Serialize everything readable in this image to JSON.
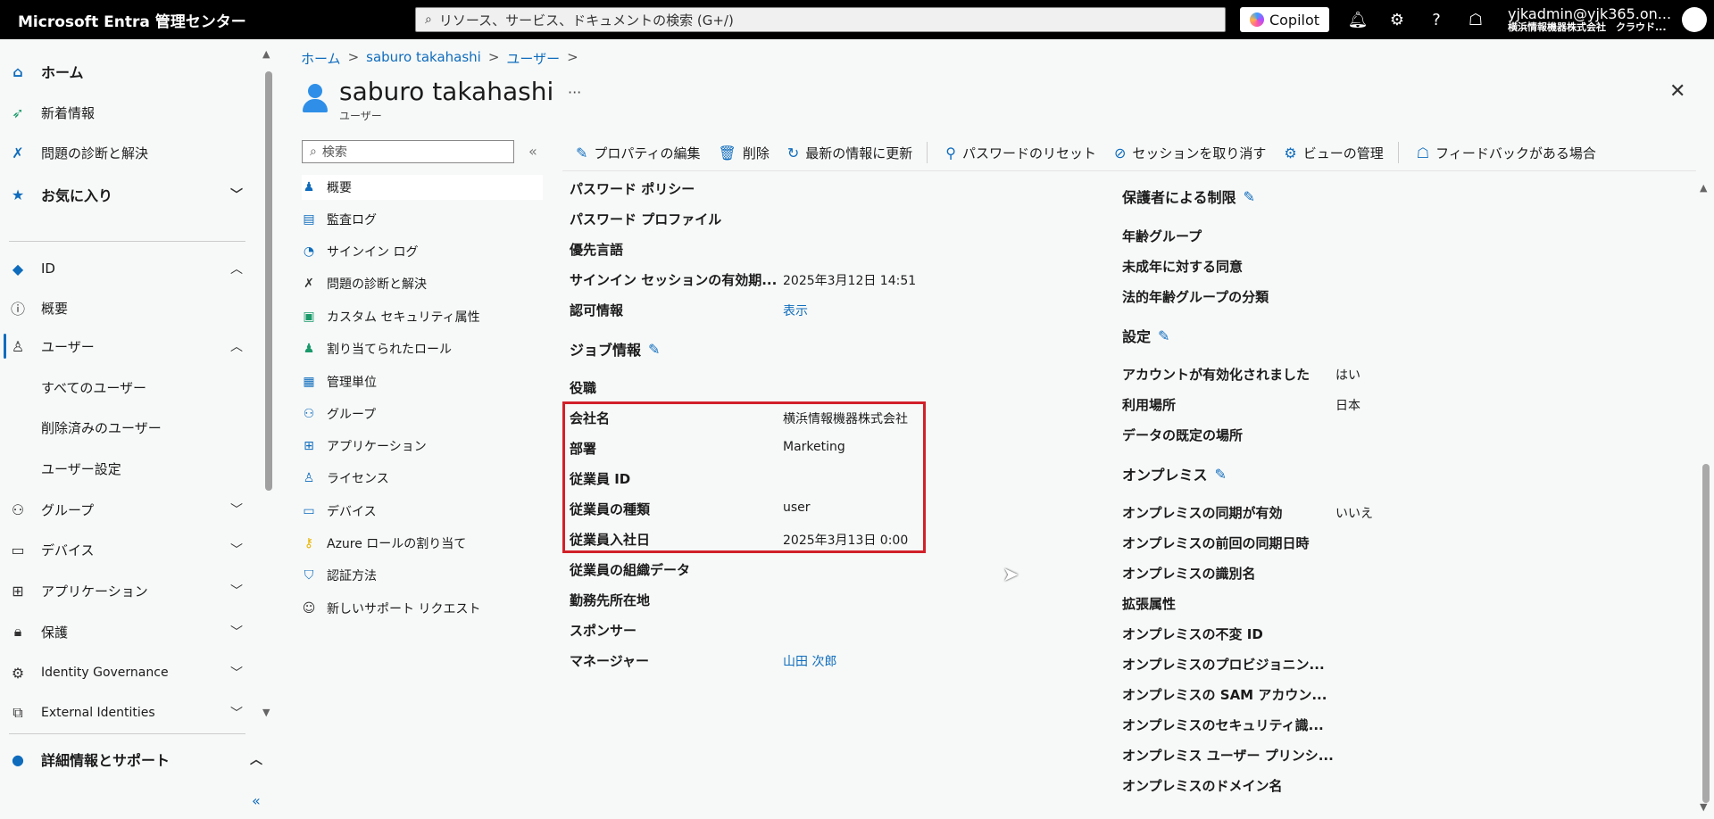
{
  "topbar": {
    "brand": "Microsoft Entra 管理センター",
    "search_placeholder": "リソース、サービス、ドキュメントの検索 (G+/)",
    "copilot": "Copilot",
    "account_user": "yjkadmin@yjk365.on...",
    "account_tenant": "横浜情報機器株式会社　クラウド..."
  },
  "leftnav": {
    "home": "ホーム",
    "whats_new": "新着情報",
    "diagnose": "問題の診断と解決",
    "favorites": "お気に入り",
    "id": "ID",
    "overview": "概要",
    "users": "ユーザー",
    "all_users": "すべてのユーザー",
    "deleted_users": "削除済みのユーザー",
    "user_settings": "ユーザー設定",
    "groups": "グループ",
    "devices": "デバイス",
    "applications": "アプリケーション",
    "protection": "保護",
    "identity_governance": "Identity Governance",
    "external_identities": "External Identities",
    "learn_support": "詳細情報とサポート"
  },
  "breadcrumb": [
    "ホーム",
    "saburo takahashi",
    "ユーザー"
  ],
  "header": {
    "title": "saburo takahashi",
    "subtitle": "ユーザー"
  },
  "submenu": {
    "search_placeholder": "検索",
    "items": [
      "概要",
      "監査ログ",
      "サインイン ログ",
      "問題の診断と解決",
      "カスタム セキュリティ属性",
      "割り当てられたロール",
      "管理単位",
      "グループ",
      "アプリケーション",
      "ライセンス",
      "デバイス",
      "Azure ロールの割り当て",
      "認証方法",
      "新しいサポート リクエスト"
    ]
  },
  "toolbar": {
    "edit": "プロパティの編集",
    "delete": "削除",
    "refresh": "最新の情報に更新",
    "reset_password": "パスワードのリセット",
    "revoke_sessions": "セッションを取り消す",
    "manage_view": "ビューの管理",
    "feedback": "フィードバックがある場合"
  },
  "left_props": {
    "password_policy": "パスワード ポリシー",
    "password_profile": "パスワード プロファイル",
    "preferred_language": "優先言語",
    "signin_session_label": "サインイン セッションの有効期...",
    "signin_session_value": "2025年3月12日 14:51",
    "authorization_label": "認可情報",
    "authorization_value": "表示",
    "job_info_title": "ジョブ情報",
    "job_title": "役職",
    "company_label": "会社名",
    "company_value": "横浜情報機器株式会社",
    "department_label": "部署",
    "department_value": "Marketing",
    "employee_id_label": "従業員 ID",
    "employee_type_label": "従業員の種類",
    "employee_type_value": "user",
    "hire_date_label": "従業員入社日",
    "hire_date_value": "2025年3月13日 0:00",
    "org_data": "従業員の組織データ",
    "office_location": "勤務先所在地",
    "sponsor": "スポンサー",
    "manager_label": "マネージャー",
    "manager_value": "山田 次郎"
  },
  "right_props": {
    "parental_title": "保護者による制限",
    "age_group": "年齢グループ",
    "minor_consent": "未成年に対する同意",
    "legal_age": "法的年齢グループの分類",
    "settings_title": "設定",
    "account_enabled_label": "アカウントが有効化されました",
    "account_enabled_value": "はい",
    "usage_location_label": "利用場所",
    "usage_location_value": "日本",
    "data_location": "データの既定の場所",
    "onprem_title": "オンプレミス",
    "onprem_sync_label": "オンプレミスの同期が有効",
    "onprem_sync_value": "いいえ",
    "onprem_last_sync": "オンプレミスの前回の同期日時",
    "onprem_identifier": "オンプレミスの識別名",
    "extension_attrs": "拡張属性",
    "onprem_immutable": "オンプレミスの不変 ID",
    "onprem_provisioning": "オンプレミスのプロビジョニン...",
    "onprem_sam": "オンプレミスの SAM アカウン...",
    "onprem_security": "オンプレミスのセキュリティ識...",
    "onprem_upn": "オンプレミス ユーザー プリンシ...",
    "onprem_domain": "オンプレミスのドメイン名"
  },
  "colors": {
    "accent": "#0f6cbd",
    "highlight": "#d1202a"
  }
}
